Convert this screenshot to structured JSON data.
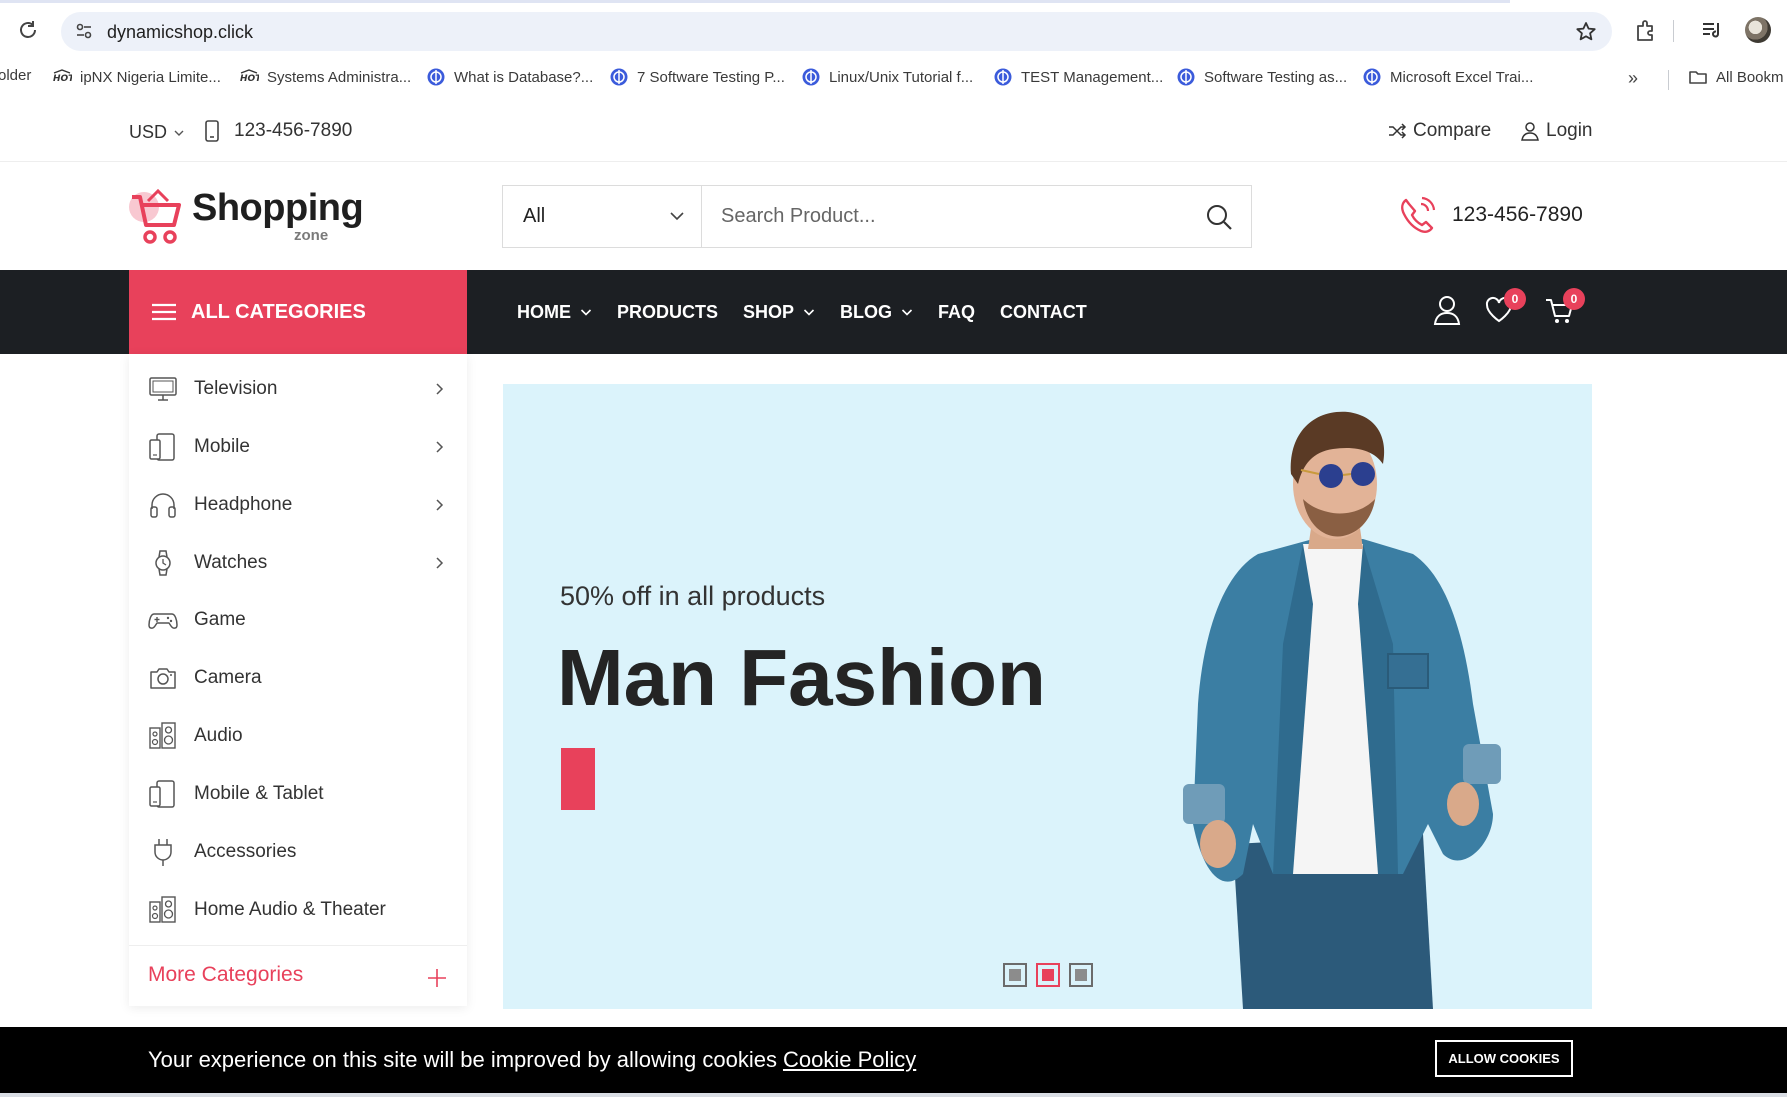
{
  "browser": {
    "url": "dynamicshop.click",
    "bookmarks": [
      {
        "label": "older",
        "icon": "folder-icon"
      },
      {
        "label": "ipNX Nigeria Limite...",
        "icon": "hot-icon"
      },
      {
        "label": "Systems Administra...",
        "icon": "hot-icon"
      },
      {
        "label": "What is Database?...",
        "icon": "globe-icon"
      },
      {
        "label": "7 Software Testing P...",
        "icon": "globe-icon"
      },
      {
        "label": "Linux/Unix Tutorial f...",
        "icon": "globe-icon"
      },
      {
        "label": "TEST Management...",
        "icon": "globe-icon"
      },
      {
        "label": "Software Testing as...",
        "icon": "globe-icon"
      },
      {
        "label": "Microsoft Excel Trai...",
        "icon": "globe-icon"
      }
    ],
    "more_bookmarks": "»",
    "all_bookmarks": "All Bookm"
  },
  "topbar": {
    "currency": "USD",
    "phone": "123-456-7890",
    "compare": "Compare",
    "login": "Login"
  },
  "header": {
    "logo_word": "Shopping",
    "logo_sub": "zone",
    "category_select": "All",
    "search_placeholder": "Search Product...",
    "phone": "123-456-7890"
  },
  "nav": {
    "all_categories": "ALL CATEGORIES",
    "items": [
      {
        "label": "HOME",
        "dropdown": true
      },
      {
        "label": "PRODUCTS",
        "dropdown": false
      },
      {
        "label": "SHOP",
        "dropdown": true
      },
      {
        "label": "BLOG",
        "dropdown": true
      },
      {
        "label": "FAQ",
        "dropdown": false
      },
      {
        "label": "CONTACT",
        "dropdown": false
      }
    ],
    "wishlist_count": "0",
    "cart_count": "0"
  },
  "categories": {
    "items": [
      {
        "label": "Television",
        "icon": "television-icon",
        "has_sub": true
      },
      {
        "label": "Mobile",
        "icon": "mobile-icon",
        "has_sub": true
      },
      {
        "label": "Headphone",
        "icon": "headphone-icon",
        "has_sub": true
      },
      {
        "label": "Watches",
        "icon": "watch-icon",
        "has_sub": true
      },
      {
        "label": "Game",
        "icon": "gamepad-icon",
        "has_sub": false
      },
      {
        "label": "Camera",
        "icon": "camera-icon",
        "has_sub": false
      },
      {
        "label": "Audio",
        "icon": "speaker-icon",
        "has_sub": false
      },
      {
        "label": "Mobile & Tablet",
        "icon": "tablet-icon",
        "has_sub": false
      },
      {
        "label": "Accessories",
        "icon": "plug-icon",
        "has_sub": false
      },
      {
        "label": "Home Audio & Theater",
        "icon": "speaker-icon",
        "has_sub": false
      }
    ],
    "more": "More Categories"
  },
  "hero": {
    "subtitle": "50% off in all products",
    "title": "Man Fashion",
    "slide_count": 3,
    "active_slide": 2,
    "background": "#dbf3fb",
    "accent": "#e8415b"
  },
  "cookie": {
    "text": "Your experience on this site will be improved by allowing cookies",
    "link": "Cookie Policy",
    "button": "ALLOW COOKIES"
  },
  "colors": {
    "accent": "#e8415b",
    "nav_bg": "#1c1f23",
    "hero_bg": "#dbf3fb"
  }
}
